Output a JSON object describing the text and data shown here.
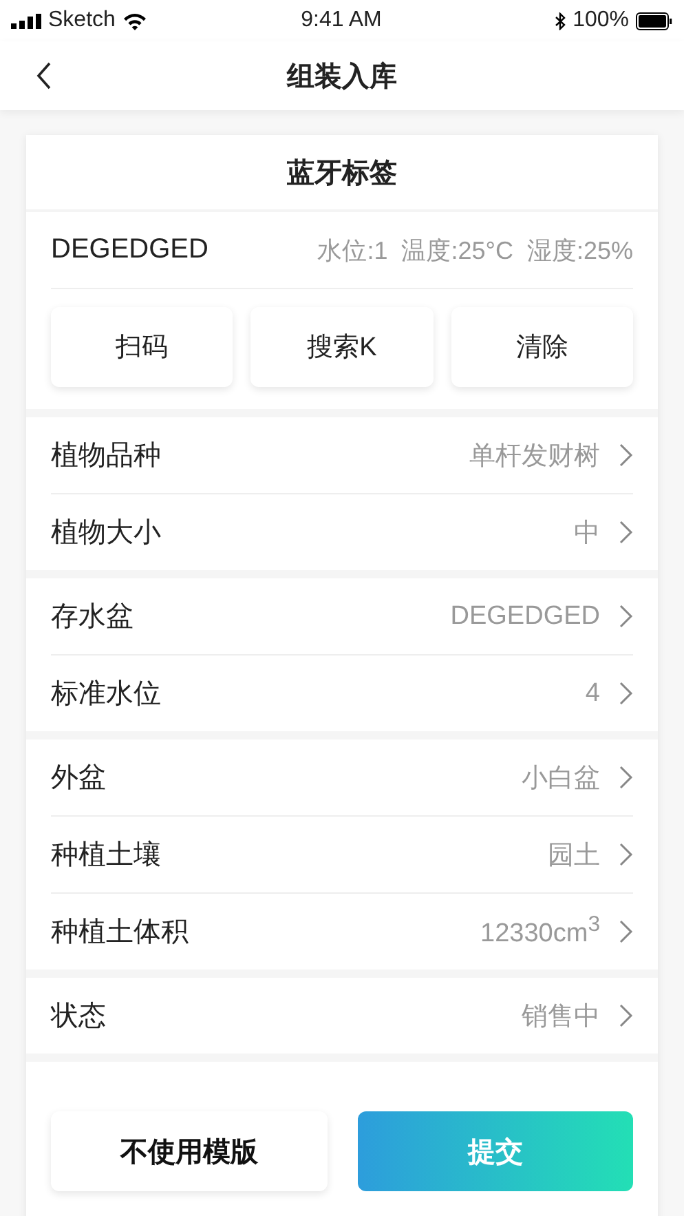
{
  "status_bar": {
    "carrier": "Sketch",
    "time": "9:41 AM",
    "battery": "100%"
  },
  "nav": {
    "title": "组装入库"
  },
  "card": {
    "title": "蓝牙标签",
    "tag": {
      "id": "DEGEDGED",
      "readings": [
        "水位:1",
        "温度:25°C",
        "湿度:25%"
      ]
    },
    "actions": [
      "扫码",
      "搜索K",
      "清除"
    ]
  },
  "groups": [
    [
      {
        "label": "植物品种",
        "value": "单杆发财树"
      },
      {
        "label": "植物大小",
        "value": "中"
      }
    ],
    [
      {
        "label": "存水盆",
        "value": "DEGEDGED"
      },
      {
        "label": "标准水位",
        "value": "4"
      }
    ],
    [
      {
        "label": "外盆",
        "value": "小白盆"
      },
      {
        "label": "种植土壤",
        "value": "园土"
      },
      {
        "label": "种植土体积",
        "value": "12330cm$^{3}$"
      }
    ],
    [
      {
        "label": "状态",
        "value": "销售中"
      }
    ]
  ],
  "footer": {
    "secondary": "不使用模版",
    "primary": "提交"
  }
}
